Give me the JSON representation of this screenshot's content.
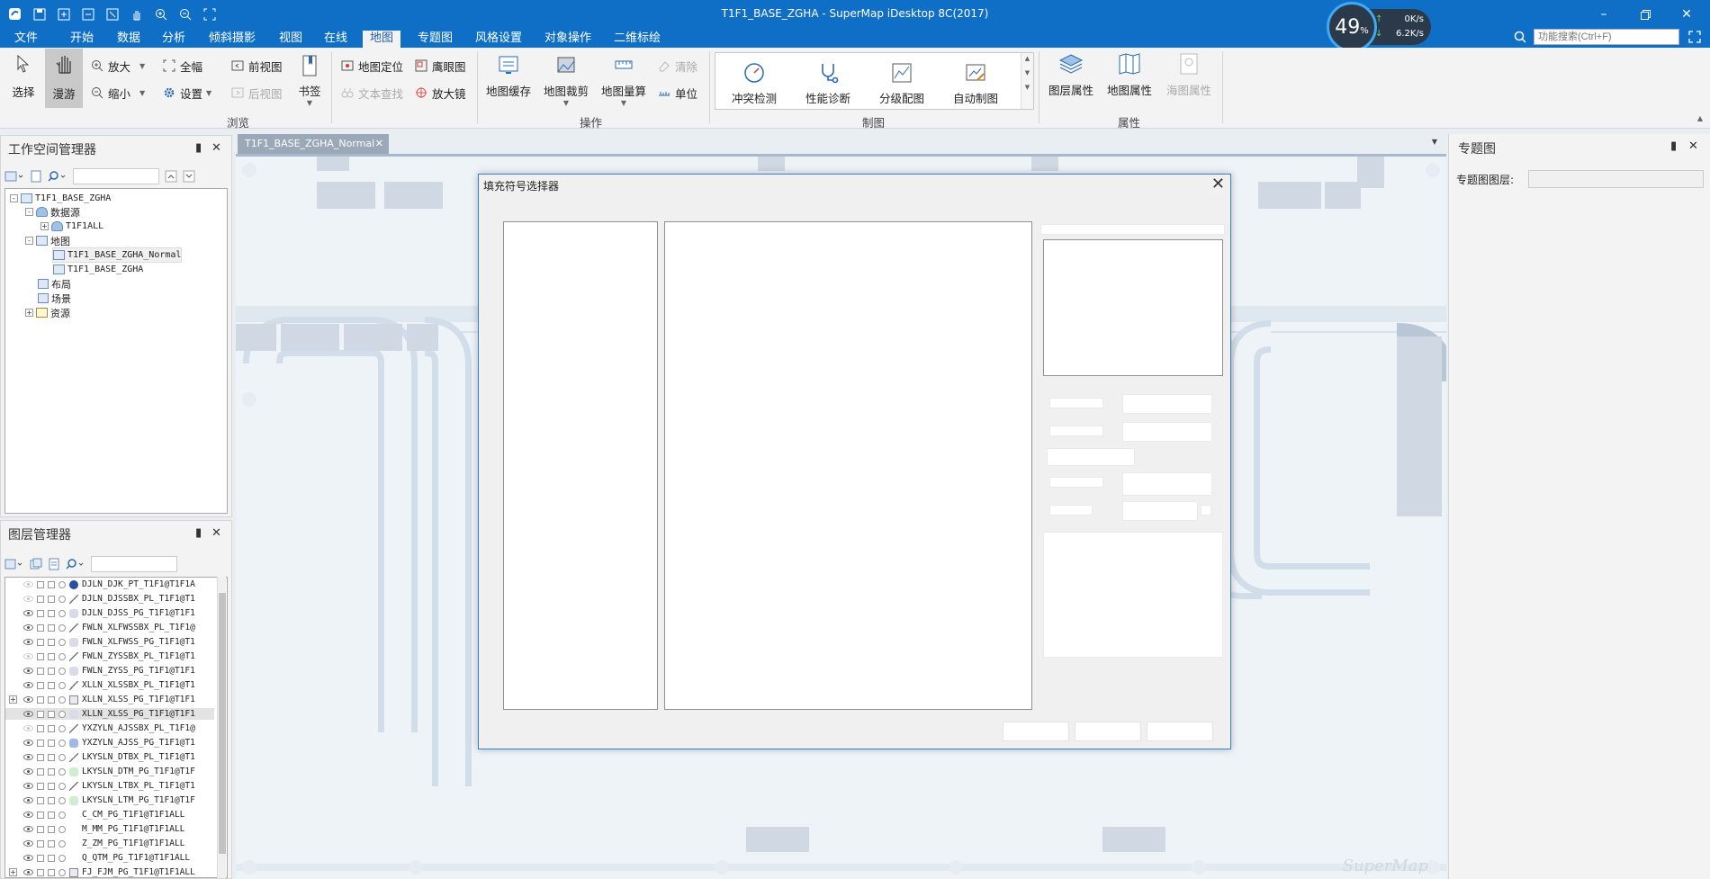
{
  "app": {
    "title": "T1F1_BASE_ZGHA - SuperMap iDesktop 8C(2017)"
  },
  "menu": [
    "文件",
    "开始",
    "数据",
    "分析",
    "倾斜摄影",
    "视图",
    "在线",
    "地图",
    "专题图",
    "风格设置",
    "对象操作",
    "二维标绘"
  ],
  "menu_active": "地图",
  "net_widget": {
    "percent": "49",
    "unit": "%",
    "up": "0K/s",
    "down": "6.2K/s"
  },
  "search": {
    "placeholder": "功能搜索(Ctrl+F)"
  },
  "ribbon": {
    "browse": {
      "label": "浏览",
      "select": "选择",
      "pan": "漫游",
      "zoom_in": "放大",
      "zoom_out": "缩小",
      "full_extent": "全幅",
      "settings": "设置",
      "prev_view": "前视图",
      "next_view": "后视图",
      "bookmark": "书签"
    },
    "operate": {
      "label": "操作",
      "locate": "地图定位",
      "text_find": "文本查找",
      "eagle_eye": "鹰眼图",
      "magnifier": "放大镜",
      "cache": "地图缓存",
      "clip": "地图裁剪",
      "measure": "地图量算",
      "clear": "清除",
      "unit": "单位"
    },
    "cartography": {
      "label": "制图",
      "conflict": "冲突检测",
      "diagnose": "性能诊断",
      "graded": "分级配图",
      "auto": "自动制图"
    },
    "properties": {
      "label": "属性",
      "layer_props": "图层属性",
      "map_props": "地图属性",
      "chart_props": "海图属性"
    }
  },
  "workspace_panel": {
    "title": "工作空间管理器",
    "tree": {
      "root": "T1F1_BASE_ZGHA",
      "datasources": "数据源",
      "datasource_item": "T1F1ALL",
      "maps": "地图",
      "map_items": [
        "T1F1_BASE_ZGHA_Normal",
        "T1F1_BASE_ZGHA"
      ],
      "layouts": "布局",
      "scenes": "场景",
      "resources": "资源"
    }
  },
  "layer_panel": {
    "title": "图层管理器",
    "layers": [
      "DJLN_DJK_PT_T1F1@T1F1A",
      "DJLN_DJSSBX_PL_T1F1@T1",
      "DJLN_DJSS_PG_T1F1@T1F1",
      "FWLN_XLFWSSBX_PL_T1F1@",
      "FWLN_XLFWSS_PG_T1F1@T1",
      "FWLN_ZYSSBX_PL_T1F1@T1",
      "FWLN_ZYSS_PG_T1F1@T1F1",
      "XLLN_XLSSBX_PL_T1F1@T1",
      "XLLN_XLSS_PG_T1F1@T1F1",
      "XLLN_XLSS_PG_T1F1@T1F1",
      "YXZYLN_AJSSBX_PL_T1F1@",
      "YXZYLN_AJSS_PG_T1F1@T1",
      "LKYSLN_DTBX_PL_T1F1@T1",
      "LKYSLN_DTM_PG_T1F1@T1F",
      "LKYSLN_LTBX_PL_T1F1@T1",
      "LKYSLN_LTM_PG_T1F1@T1F",
      "C_CM_PG_T1F1@T1F1ALL",
      "M_MM_PG_T1F1@T1F1ALL",
      "Z_ZM_PG_T1F1@T1F1ALL",
      "Q_QTM_PG_T1F1@T1F1ALL",
      "FJ_FJM_PG_T1F1@T1F1ALL"
    ]
  },
  "map_tab": {
    "label": "T1F1_BASE_ZGHA_Normal"
  },
  "watermark": "SuperMap",
  "right_panel": {
    "title": "专题图",
    "layer_label": "专题图图层:"
  },
  "dialog": {
    "title": "填充符号选择器"
  },
  "colors": {
    "titlebar": "#0f6fc7",
    "accent": "#3c7fc0",
    "selected_row": "#e3e3e3"
  }
}
